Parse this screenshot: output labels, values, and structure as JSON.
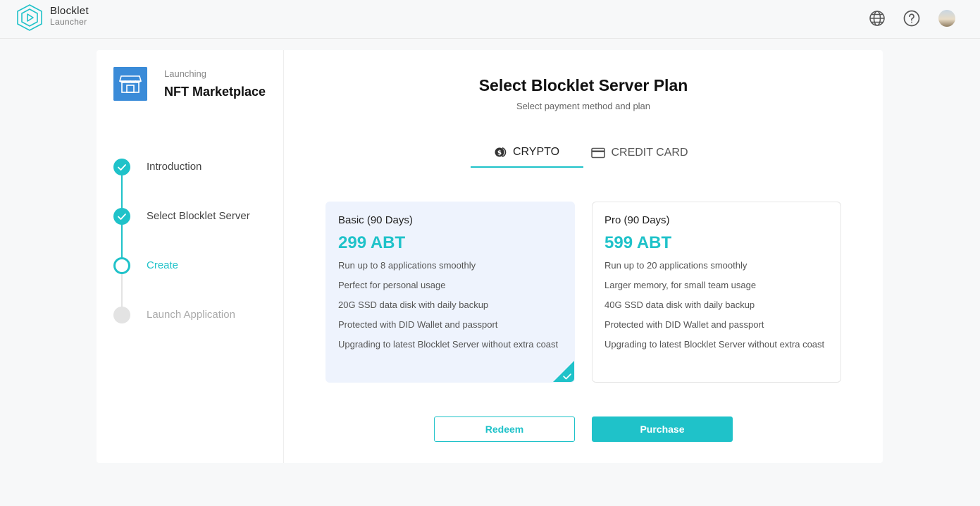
{
  "header": {
    "brand_name": "Blocklet",
    "brand_sub": "Launcher",
    "icons": [
      "globe-icon",
      "help-icon",
      "avatar"
    ]
  },
  "sidebar": {
    "launching_label": "Launching",
    "app_name": "NFT Marketplace",
    "steps": [
      {
        "label": "Introduction",
        "state": "done"
      },
      {
        "label": "Select Blocklet Server",
        "state": "done"
      },
      {
        "label": "Create",
        "state": "active"
      },
      {
        "label": "Launch Application",
        "state": "todo"
      }
    ]
  },
  "main": {
    "title": "Select Blocklet Server Plan",
    "subtitle": "Select payment method and plan",
    "tabs": [
      {
        "label": "CRYPTO",
        "icon": "coin-icon",
        "selected": true
      },
      {
        "label": "CREDIT CARD",
        "icon": "credit-card-icon",
        "selected": false
      }
    ],
    "plans": [
      {
        "name": "Basic (90 Days)",
        "price": "299 ABT",
        "selected": true,
        "features": [
          "Run up to 8 applications smoothly",
          "Perfect for personal usage",
          "20G SSD data disk with daily backup",
          "Protected with DID Wallet and passport",
          "Upgrading to latest Blocklet Server without extra coast"
        ]
      },
      {
        "name": "Pro (90 Days)",
        "price": "599 ABT",
        "selected": false,
        "features": [
          "Run up to 20 applications smoothly",
          "Larger memory, for small team usage",
          "40G SSD data disk with daily backup",
          "Protected with DID Wallet and passport",
          "Upgrading to latest Blocklet Server without extra coast"
        ]
      }
    ],
    "buttons": {
      "redeem": "Redeem",
      "purchase": "Purchase"
    }
  },
  "colors": {
    "accent": "#1fc2c9",
    "selected_plan_bg": "#eef3fd",
    "app_icon_bg": "#3a8bd8"
  }
}
